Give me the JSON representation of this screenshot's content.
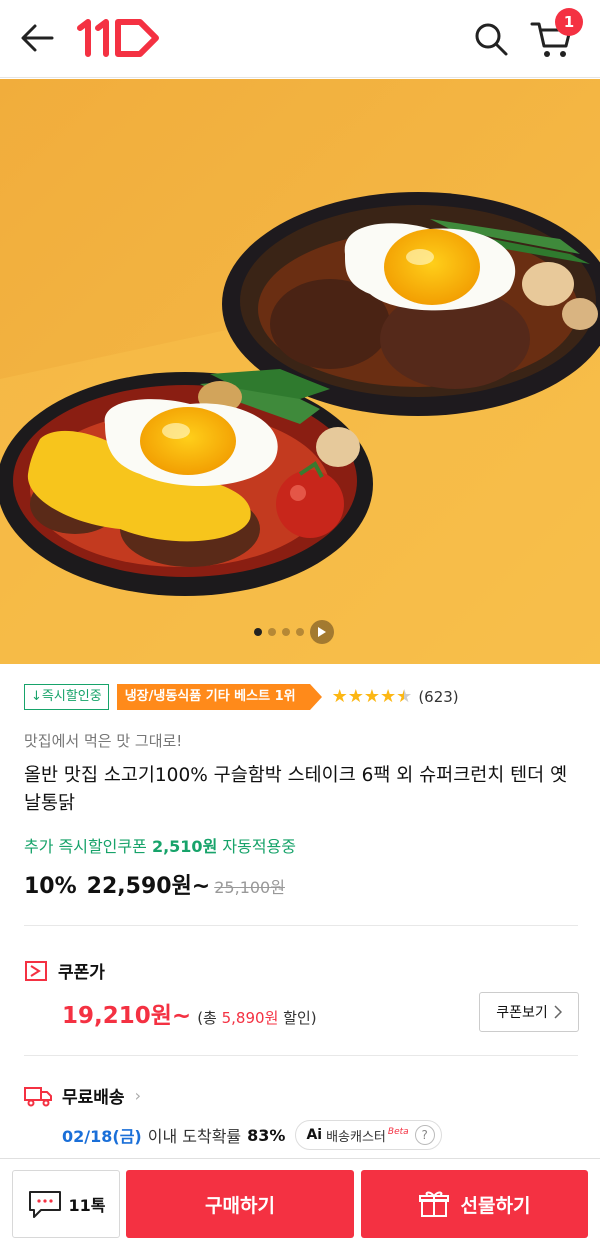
{
  "header": {
    "logo_text": "11",
    "cart_count": "1",
    "icons": [
      "back-arrow-icon",
      "search-icon",
      "cart-icon"
    ]
  },
  "hero": {
    "image_description": "two hamburg steak pans with fried eggs on yellow background",
    "carousel_index": 1,
    "carousel_total": 4
  },
  "product": {
    "tag_discount": "↓즉시할인중",
    "tag_best": "냉장/냉동식품 기타 베스트 1위",
    "rating": 4.5,
    "review_count": "(623)",
    "subtitle": "맛집에서 먹은 맛 그대로!",
    "title": "올반 맛집 소고기100% 구슬함박 스테이크 6팩 외 슈퍼크런치 텐더 옛날통닭",
    "coupon_auto_prefix": "추가 즉시할인쿠폰",
    "coupon_auto_amount": "2,510원",
    "coupon_auto_suffix": "자동적용중",
    "discount_rate": "10%",
    "price": "22,590원~",
    "original_price": "25,100원"
  },
  "coupon": {
    "label": "쿠폰가",
    "price": "19,210원~",
    "note_prefix": "(총",
    "note_amount": "5,890원",
    "note_suffix": "할인)",
    "view_button": "쿠폰보기"
  },
  "shipping": {
    "label": "무료배송",
    "date": "02/18(금)",
    "text": "이내 도착확률",
    "rate": "83%",
    "ai_label": "Ai",
    "ai_text": "배송캐스터",
    "ai_beta": "Beta",
    "help": "?"
  },
  "bottom": {
    "talk_label": "11톡",
    "buy_label": "구매하기",
    "gift_label": "선물하기"
  },
  "colors": {
    "brand_red": "#f43142",
    "green": "#17a36a",
    "orange": "#ff8a1a",
    "star": "#fcb714",
    "blue": "#1a6fd8"
  }
}
